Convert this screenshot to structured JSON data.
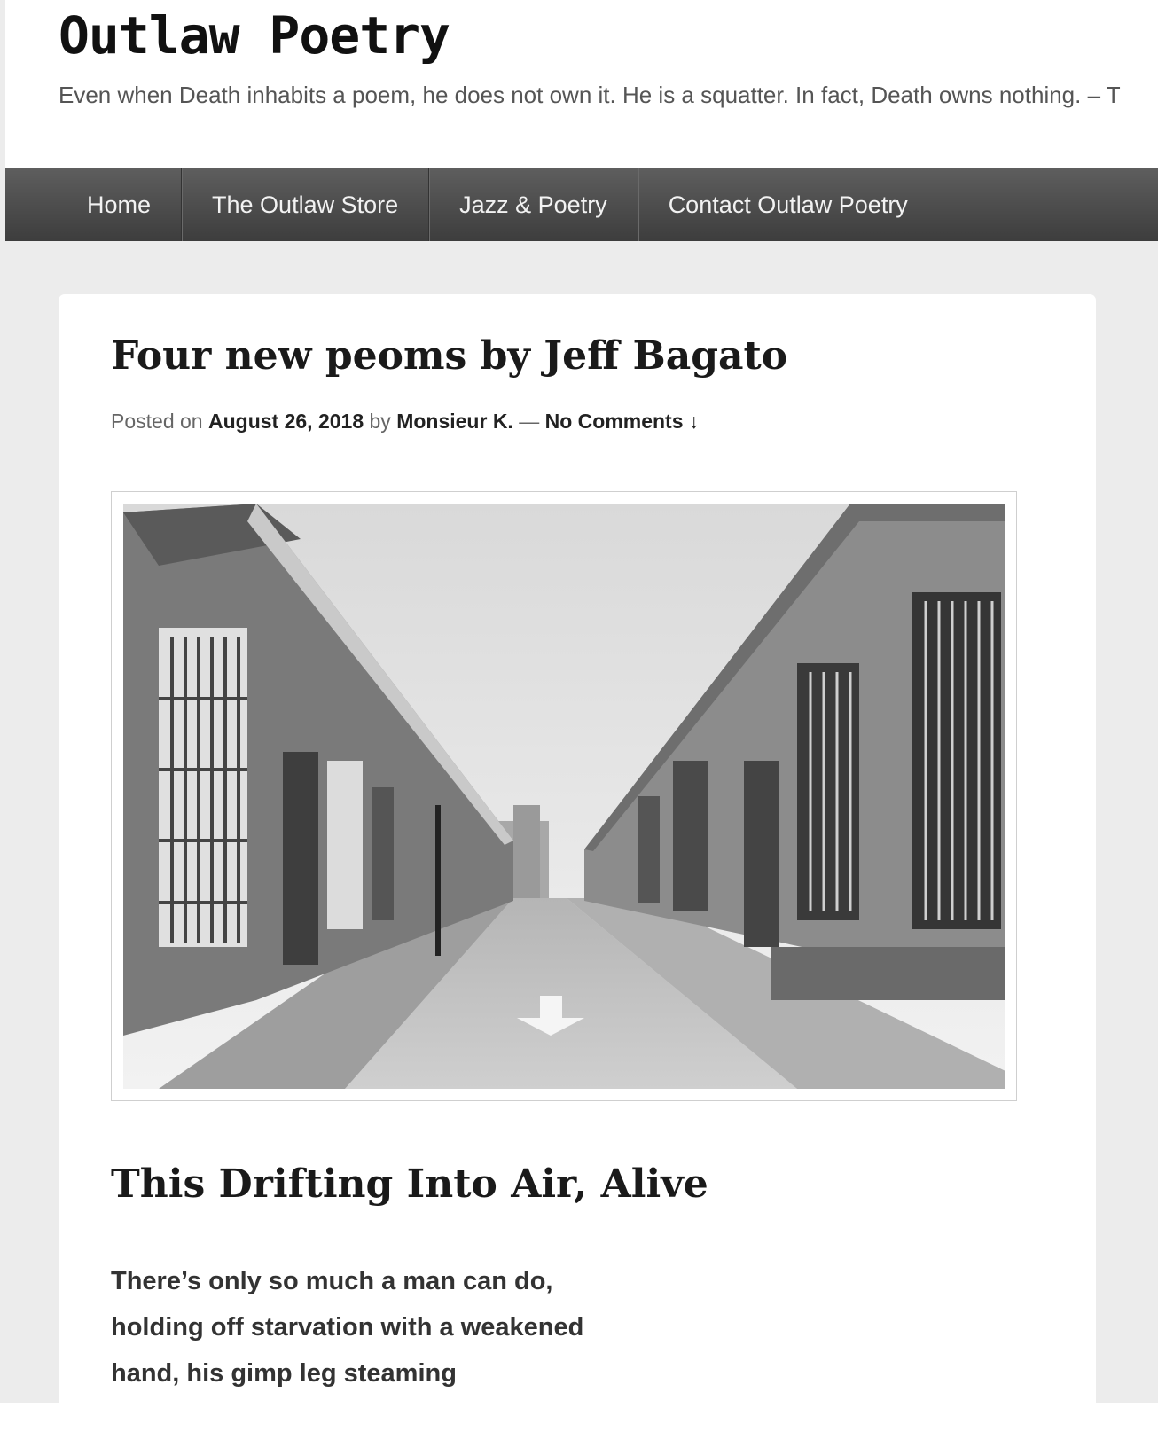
{
  "site": {
    "title": "Outlaw Poetry",
    "tagline": "Even when Death inhabits a poem, he does not own it. He is a squatter. In fact, Death owns nothing. – T"
  },
  "nav": {
    "items": [
      {
        "label": "Home"
      },
      {
        "label": "The Outlaw Store"
      },
      {
        "label": "Jazz & Poetry"
      },
      {
        "label": "Contact Outlaw Poetry"
      }
    ]
  },
  "post": {
    "title": "Four new peoms by Jeff Bagato",
    "meta": {
      "posted_on": "Posted on",
      "date": "August 26, 2018",
      "by": "by",
      "author": "Monsieur K.",
      "separator": "—",
      "comments": "No Comments ↓"
    },
    "image_icon": "street-photo-image"
  },
  "poem": {
    "title": "This Drifting Into Air, Alive",
    "lines": [
      "There’s only so much a man can do,",
      "holding off starvation with a weakened",
      "hand, his gimp leg steaming"
    ]
  },
  "colors": {
    "nav_bg_top": "#5e5e5e",
    "nav_bg_bottom": "#3d3d3d",
    "page_bg": "#ececec",
    "card_bg": "#ffffff"
  }
}
